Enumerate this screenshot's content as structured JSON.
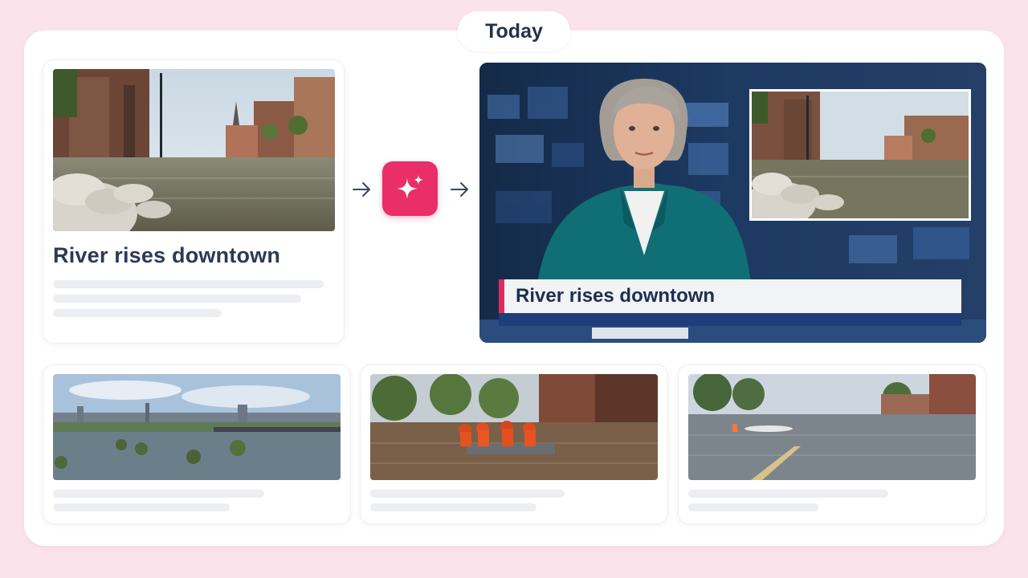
{
  "header": {
    "pill_label": "Today"
  },
  "source_article": {
    "headline": "River rises downtown",
    "image": "flooded-downtown-street-with-sandbags"
  },
  "generate_button": {
    "icon": "sparkle-icon",
    "color": "#ea2e68"
  },
  "video_preview": {
    "lower_third_text": "River rises downtown",
    "accent_color": "#e02b5d",
    "bar_color": "#1f3d7a"
  },
  "related_articles": [
    {
      "image": "flooded-riverside-city-skyline"
    },
    {
      "image": "rescue-boat-on-flooded-street"
    },
    {
      "image": "flooded-road-with-traffic-cone"
    }
  ]
}
